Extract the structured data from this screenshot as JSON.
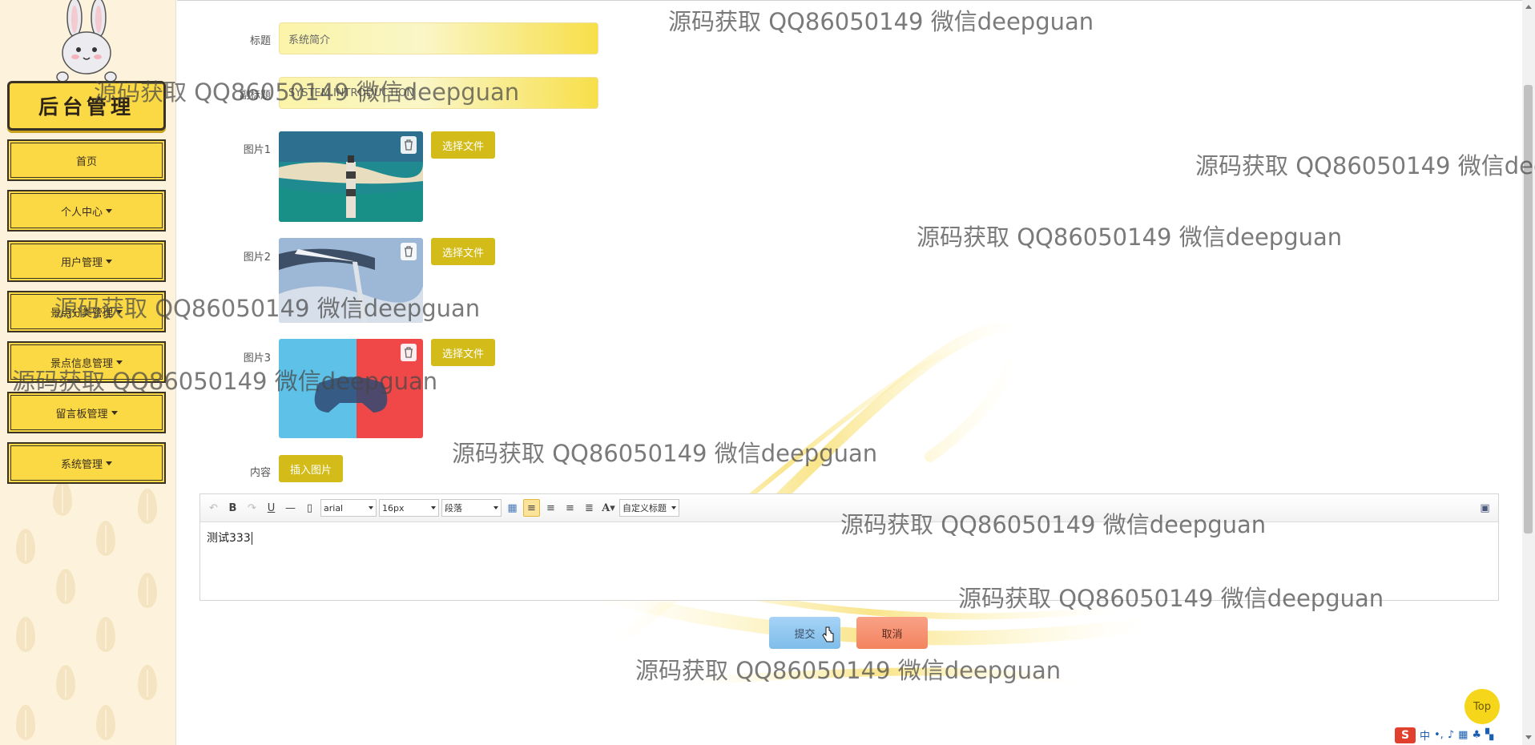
{
  "sidebar": {
    "logo_text": "后台管理",
    "items": [
      {
        "label": "首页",
        "has_caret": false
      },
      {
        "label": "个人中心",
        "has_caret": true
      },
      {
        "label": "用户管理",
        "has_caret": true
      },
      {
        "label": "景点分类管理",
        "has_caret": true
      },
      {
        "label": "景点信息管理",
        "has_caret": true
      },
      {
        "label": "留言板管理",
        "has_caret": true
      },
      {
        "label": "系统管理",
        "has_caret": true
      }
    ]
  },
  "form": {
    "title_label": "标题",
    "title_value": "系统简介",
    "subtitle_label": "副标题",
    "subtitle_value": "SYSTEM INTRODUCTION",
    "image1_label": "图片1",
    "image2_label": "图片2",
    "image3_label": "图片3",
    "choose_file_label": "选择文件",
    "content_label": "内容",
    "insert_image_label": "插入图片"
  },
  "editor": {
    "font_family": "arial",
    "font_size": "16px",
    "paragraph": "段落",
    "custom_heading": "自定义标题",
    "content": "测试333"
  },
  "actions": {
    "submit_label": "提交",
    "cancel_label": "取消",
    "top_label": "Top"
  },
  "tray": {
    "ime_lang": "中"
  },
  "watermark": {
    "text": "源码获取 QQ86050149 微信deepguan"
  },
  "colors": {
    "sidebar_bg": "#fdf3dc",
    "menu_yellow": "#fbd944",
    "button_yellow": "#d3bb1a",
    "submit_blue": "#7fbde9",
    "cancel_orange": "#f3835f",
    "top_button": "#f6d61b"
  },
  "icons": [
    "rabbit-logo",
    "trash-icon",
    "undo-icon",
    "redo-icon",
    "bold-icon",
    "underline-icon",
    "horizontal-rule-icon",
    "page-icon",
    "table-icon",
    "align-left-icon",
    "align-right-icon",
    "align-center-icon",
    "justify-icon",
    "font-color-icon",
    "fullscreen-icon",
    "hand-cursor-icon"
  ]
}
